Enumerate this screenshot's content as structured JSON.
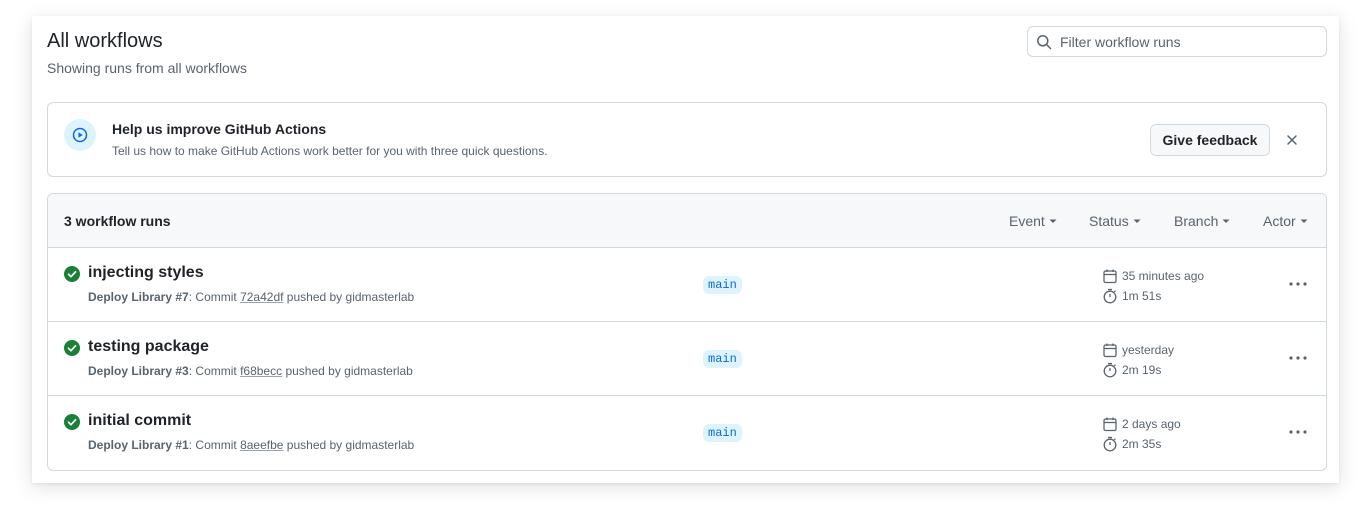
{
  "page": {
    "title": "All workflows",
    "subtitle": "Showing runs from all workflows",
    "search_placeholder": "Filter workflow runs"
  },
  "banner": {
    "title": "Help us improve GitHub Actions",
    "description": "Tell us how to make GitHub Actions work better for you with three quick questions.",
    "button_label": "Give feedback",
    "icon": "play-circle-icon"
  },
  "runs": {
    "count_label": "3 workflow runs",
    "filters": [
      "Event",
      "Status",
      "Branch",
      "Actor"
    ],
    "items": [
      {
        "title": "injecting styles",
        "workflow": "Deploy Library",
        "run_number": "#7",
        "commit_prefix": ": Commit ",
        "commit": "72a42df",
        "pushed_by": " pushed by gidmasterlab",
        "branch": "main",
        "time": "35 minutes ago",
        "duration": "1m 51s",
        "status": "success"
      },
      {
        "title": "testing package",
        "workflow": "Deploy Library",
        "run_number": "#3",
        "commit_prefix": ": Commit ",
        "commit": "f68becc",
        "pushed_by": " pushed by gidmasterlab",
        "branch": "main",
        "time": "yesterday",
        "duration": "2m 19s",
        "status": "success"
      },
      {
        "title": "initial commit",
        "workflow": "Deploy Library",
        "run_number": "#1",
        "commit_prefix": ": Commit ",
        "commit": "8aeefbe",
        "pushed_by": " pushed by gidmasterlab",
        "branch": "main",
        "time": "2 days ago",
        "duration": "2m 35s",
        "status": "success"
      }
    ]
  },
  "colors": {
    "success": "#1a7f37",
    "accent": "#0969da",
    "branch_bg": "#ddf4ff",
    "muted_text": "#59636e",
    "border": "#d1d9e0"
  }
}
